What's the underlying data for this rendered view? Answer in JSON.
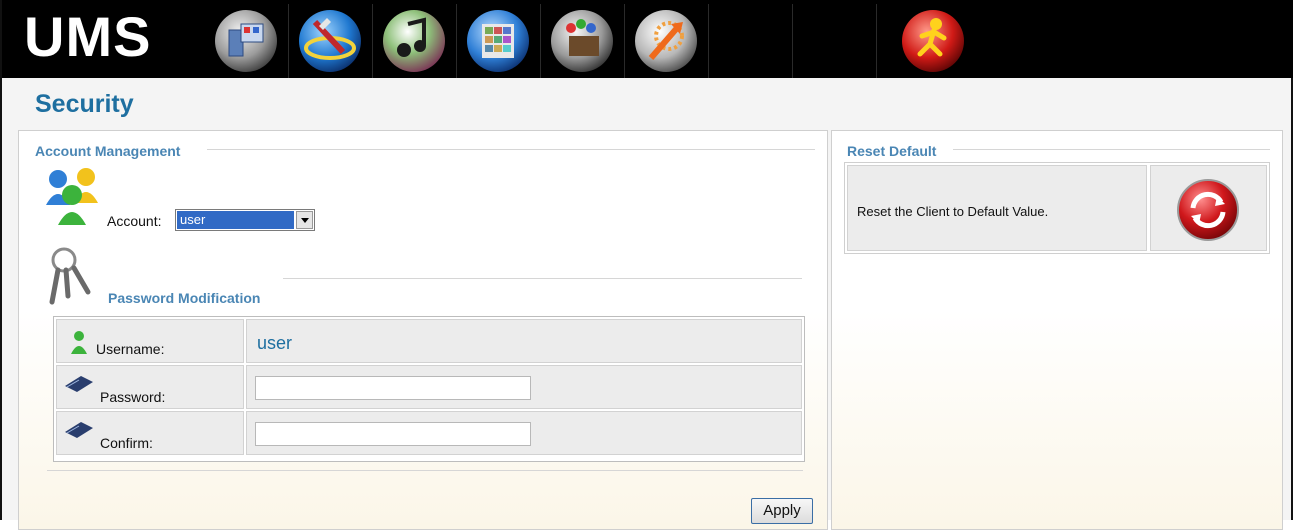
{
  "app": {
    "logo": "UMS"
  },
  "nav": {
    "icons": [
      "device-manager-icon",
      "satellite-icon",
      "music-icon",
      "grid-apps-icon",
      "palette-icon",
      "sun-arrow-icon",
      "exit-runner-icon"
    ]
  },
  "page": {
    "title": "Security"
  },
  "account_management": {
    "legend": "Account Management",
    "account_label": "Account:",
    "account_selected": "user"
  },
  "password_modification": {
    "legend": "Password Modification",
    "username_label": "Username:",
    "username_value": "user",
    "password_label": "Password:",
    "password_value": "",
    "confirm_label": "Confirm:",
    "confirm_value": "",
    "apply_label": "Apply"
  },
  "reset_default": {
    "legend": "Reset Default",
    "description": "Reset the Client to Default Value."
  },
  "colors": {
    "accent": "#1e6fa0",
    "legend": "#4a86b4",
    "topbar": "#000000"
  }
}
